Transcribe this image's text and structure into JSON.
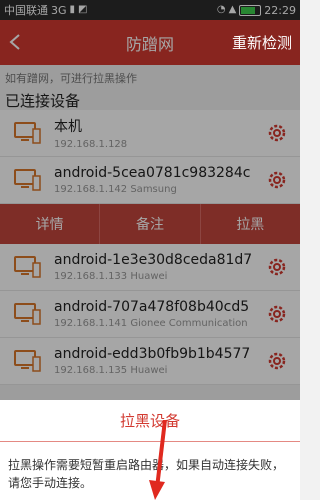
{
  "status_bar": {
    "carrier": "中国联通",
    "network": "3G",
    "time": "22:29"
  },
  "appbar": {
    "back_icon": "chevron-left-icon",
    "title": "防蹭网",
    "action_label": "重新检测"
  },
  "hint_text": "如有蹭网，可进行拉黑操作",
  "section_title": "已连接设备",
  "devices": [
    {
      "name": "本机",
      "ip": "192.168.1.128"
    },
    {
      "name": "android-5cea0781c983284c",
      "ip": "192.168.1.142 Samsung"
    },
    {
      "name": "android-1e3e30d8ceda81d7",
      "ip": "192.168.1.133 Huawei"
    },
    {
      "name": "android-707a478f08b40cd5",
      "ip": "192.168.1.141 Gionee Communication"
    },
    {
      "name": "android-edd3b0fb9b1b4577",
      "ip": "192.168.1.135 Huawei"
    }
  ],
  "row_actions": {
    "details_label": "详情",
    "note_label": "备注",
    "block_label": "拉黑"
  },
  "dialog": {
    "title": "拉黑设备",
    "message": "拉黑操作需要短暂重启路由器，如果自动连接失败，请您手动连接。"
  },
  "colors": {
    "brand_red": "#d23a31",
    "action_bar": "#c2453d",
    "device_icon": "#d9772a",
    "gear": "#d23a31"
  }
}
